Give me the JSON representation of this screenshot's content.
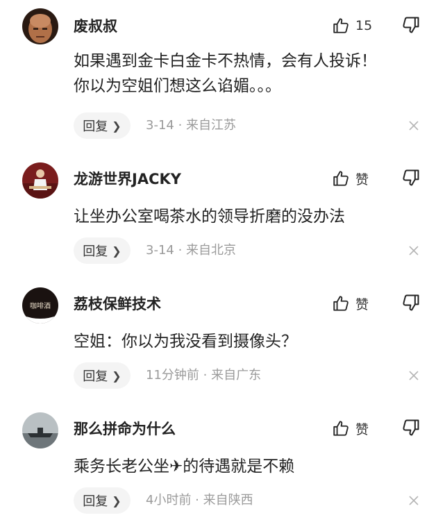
{
  "comments": [
    {
      "username": "废叔叔",
      "likes": "15",
      "avatar_icon": "bald-man-avatar",
      "content_lines": [
        "如果遇到金卡白金卡不热情，会有人投诉！",
        "你以为空姐们想这么谄媚。。。"
      ],
      "reply_label": "回复",
      "date": "3-14",
      "location": "来自江苏"
    },
    {
      "username": "龙游世界JACKY",
      "likes": "赞",
      "avatar_icon": "man-seated-avatar",
      "content_lines": [
        "让坐办公室喝茶水的领导折磨的没办法"
      ],
      "reply_label": "回复",
      "date": "3-14",
      "location": "来自北京"
    },
    {
      "username": "荔枝保鲜技术",
      "likes": "赞",
      "avatar_icon": "coffee-logo-avatar",
      "avatar_text": "咖啡酒",
      "content_lines": [
        "空姐：你以为我没看到摄像头？"
      ],
      "reply_label": "回复",
      "date": "11分钟前",
      "location": "来自广东"
    },
    {
      "username": "那么拼命为什么",
      "likes": "赞",
      "avatar_icon": "ship-on-water-avatar",
      "content_lines": [
        "乘务长老公坐✈的待遇就是不赖"
      ],
      "reply_label": "回复",
      "date": "4小时前",
      "location": "来自陕西"
    }
  ],
  "separator": " · "
}
